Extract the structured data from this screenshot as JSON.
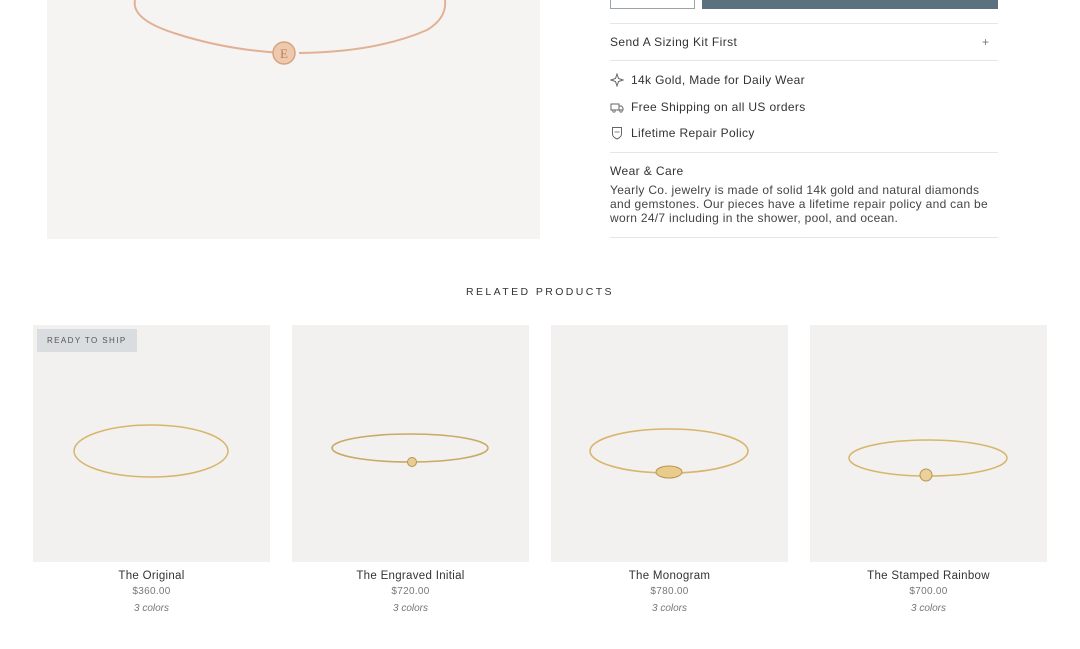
{
  "sizing": {
    "label": "Send A Sizing Kit First",
    "toggle": "+"
  },
  "features": [
    {
      "icon": "sparkle-icon",
      "text": "14k Gold, Made for Daily Wear"
    },
    {
      "icon": "truck-icon",
      "text": "Free Shipping on all US orders"
    },
    {
      "icon": "shield-icon",
      "text": "Lifetime Repair Policy"
    }
  ],
  "care": {
    "title": "Wear & Care",
    "text": "Yearly Co. jewelry is made of solid 14k gold and natural diamonds and gemstones. Our pieces have a lifetime repair policy and can be worn 24/7 including in the shower, pool, and ocean."
  },
  "hero": {
    "charm_letter": "E"
  },
  "related": {
    "title": "RELATED PRODUCTS",
    "products": [
      {
        "name": "The Original",
        "price": "$360.00",
        "colors": "3 colors",
        "badge": "READY TO SHIP"
      },
      {
        "name": "The Engraved Initial",
        "price": "$720.00",
        "colors": "3 colors"
      },
      {
        "name": "The Monogram",
        "price": "$780.00",
        "colors": "3 colors"
      },
      {
        "name": "The Stamped Rainbow",
        "price": "$700.00",
        "colors": "3 colors"
      }
    ]
  },
  "colors": {
    "accent": "#5b7180",
    "gold": "#d8b56a",
    "rose_gold": "#d9a27f"
  }
}
